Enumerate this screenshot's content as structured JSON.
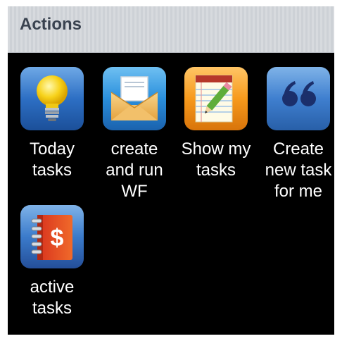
{
  "panel": {
    "title": "Actions"
  },
  "actions": [
    {
      "label": "Today\ntasks",
      "icon": "lightbulb-icon"
    },
    {
      "label": "create\nand run\nWF",
      "icon": "envelope-icon"
    },
    {
      "label": "Show my\ntasks",
      "icon": "notepad-pencil-icon"
    },
    {
      "label": "Create\nnew task\nfor me",
      "icon": "quote-icon"
    },
    {
      "label": "active\ntasks",
      "icon": "dollar-notebook-icon"
    }
  ]
}
